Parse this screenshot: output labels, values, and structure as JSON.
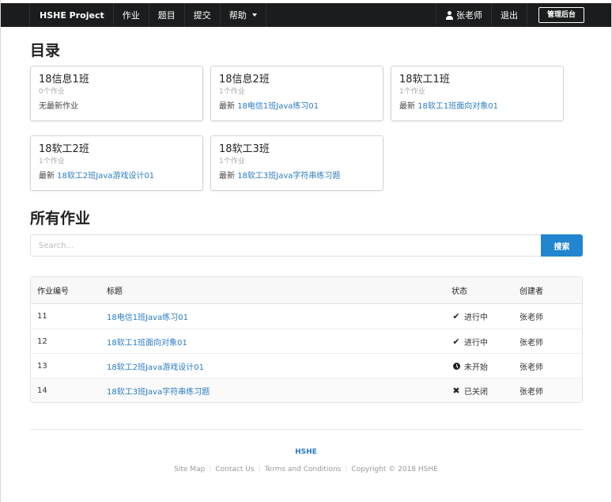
{
  "navbar": {
    "brand": "HSHE Project",
    "items": [
      {
        "label": "作业"
      },
      {
        "label": "题目"
      },
      {
        "label": "提交"
      },
      {
        "label": "帮助"
      }
    ],
    "user": "张老师",
    "logout": "退出",
    "admin": "管理后台"
  },
  "catalog": {
    "title": "目录",
    "cards": [
      {
        "title": "18信息1班",
        "count": "0个作业",
        "prefix": "无最新作业",
        "link": ""
      },
      {
        "title": "18信息2班",
        "count": "1个作业",
        "prefix": "最新",
        "link": "18电信1班Java练习01"
      },
      {
        "title": "18软工1班",
        "count": "1个作业",
        "prefix": "最新",
        "link": "18软工1班面向对象01"
      },
      {
        "title": "18软工2班",
        "count": "1个作业",
        "prefix": "最新",
        "link": "18软工2班Java游戏设计01"
      },
      {
        "title": "18软工3班",
        "count": "1个作业",
        "prefix": "最新",
        "link": "18软工3班Java字符串练习题"
      }
    ]
  },
  "assignments": {
    "title": "所有作业",
    "search_placeholder": "Search...",
    "search_button": "搜索",
    "headers": {
      "id": "作业编号",
      "title": "标题",
      "status": "状态",
      "creator": "创建者"
    },
    "rows": [
      {
        "id": "11",
        "title": "18电信1班Java练习01",
        "status": "进行中",
        "status_icon": "check-icon",
        "creator": "张老师"
      },
      {
        "id": "12",
        "title": "18软工1班面向对象01",
        "status": "进行中",
        "status_icon": "check-icon",
        "creator": "张老师"
      },
      {
        "id": "13",
        "title": "18软工2班Java游戏设计01",
        "status": "未开始",
        "status_icon": "clock-icon",
        "creator": "张老师"
      },
      {
        "id": "14",
        "title": "18软工3班Java字符串练习题",
        "status": "已关闭",
        "status_icon": "close-icon",
        "creator": "张老师"
      }
    ]
  },
  "footer": {
    "brand": "HSHE",
    "links": [
      "Site Map",
      "Contact Us",
      "Terms and Conditions",
      "Copyright © 2018 HSHE"
    ]
  },
  "colors": {
    "navbar": "#1b1c1d",
    "link": "#2a7bc3",
    "primary": "#2185d0"
  }
}
